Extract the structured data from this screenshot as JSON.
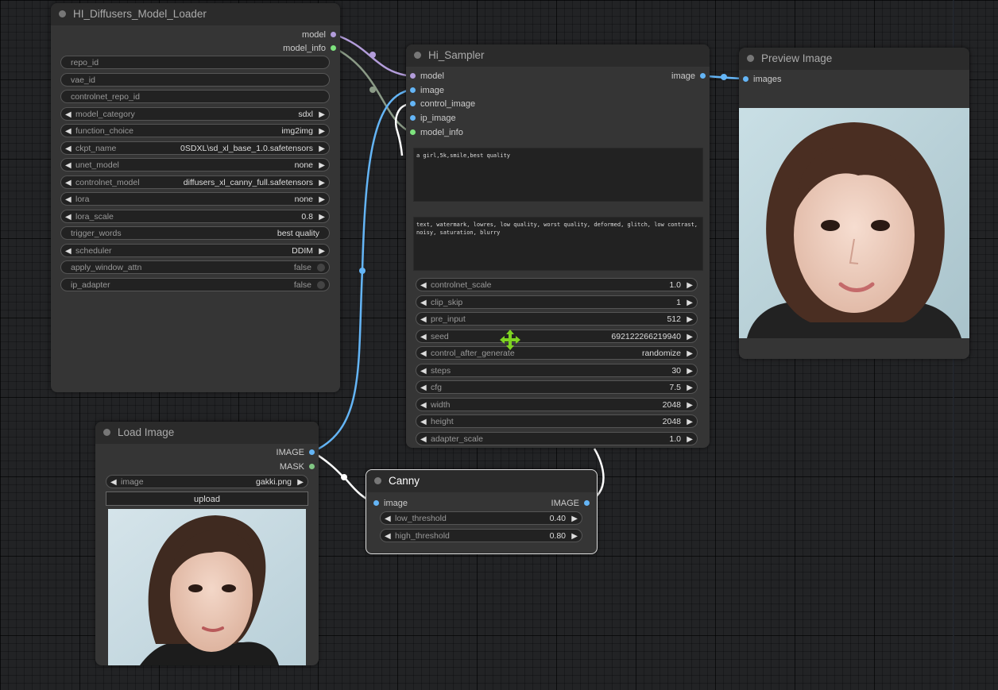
{
  "nodes": {
    "loader": {
      "title": "HI_Diffusers_Model_Loader",
      "outputs": [
        "model",
        "model_info"
      ],
      "widgets": [
        {
          "label": "repo_id",
          "value": "",
          "kind": "text"
        },
        {
          "label": "vae_id",
          "value": "",
          "kind": "text"
        },
        {
          "label": "controlnet_repo_id",
          "value": "",
          "kind": "text"
        },
        {
          "label": "model_category",
          "value": "sdxl",
          "kind": "combo"
        },
        {
          "label": "function_choice",
          "value": "img2img",
          "kind": "combo"
        },
        {
          "label": "ckpt_name",
          "value": "0SDXL\\sd_xl_base_1.0.safetensors",
          "kind": "combo"
        },
        {
          "label": "unet_model",
          "value": "none",
          "kind": "combo"
        },
        {
          "label": "controlnet_model",
          "value": "diffusers_xl_canny_full.safetensors",
          "kind": "combo"
        },
        {
          "label": "lora",
          "value": "none",
          "kind": "combo"
        },
        {
          "label": "lora_scale",
          "value": "0.8",
          "kind": "combo"
        },
        {
          "label": "trigger_words",
          "value": "best quality",
          "kind": "text"
        },
        {
          "label": "scheduler",
          "value": "DDIM",
          "kind": "combo"
        },
        {
          "label": "apply_window_attn",
          "value": "false",
          "kind": "toggle"
        },
        {
          "label": "ip_adapter",
          "value": "false",
          "kind": "toggle"
        }
      ]
    },
    "sampler": {
      "title": "Hi_Sampler",
      "inputs": [
        "model",
        "image",
        "control_image",
        "ip_image",
        "model_info"
      ],
      "outputs": [
        "image"
      ],
      "positive_prompt": "a girl,5k,smile,best quality",
      "negative_prompt": "text, watermark, lowres, low quality, worst quality, deformed, glitch, low contrast, noisy, saturation, blurry",
      "widgets": [
        {
          "label": "controlnet_scale",
          "value": "1.0"
        },
        {
          "label": "clip_skip",
          "value": "1"
        },
        {
          "label": "pre_input",
          "value": "512"
        },
        {
          "label": "seed",
          "value": "692122266219940"
        },
        {
          "label": "control_after_generate",
          "value": "randomize"
        },
        {
          "label": "steps",
          "value": "30"
        },
        {
          "label": "cfg",
          "value": "7.5"
        },
        {
          "label": "width",
          "value": "2048"
        },
        {
          "label": "height",
          "value": "2048"
        },
        {
          "label": "adapter_scale",
          "value": "1.0"
        }
      ]
    },
    "preview": {
      "title": "Preview Image",
      "inputs": [
        "images"
      ]
    },
    "load_image": {
      "title": "Load Image",
      "outputs": [
        "IMAGE",
        "MASK"
      ],
      "image_widget": {
        "label": "image",
        "value": "gakki.png"
      },
      "upload_label": "upload"
    },
    "canny": {
      "title": "Canny",
      "inputs": [
        "image"
      ],
      "outputs": [
        "IMAGE"
      ],
      "widgets": [
        {
          "label": "low_threshold",
          "value": "0.40"
        },
        {
          "label": "high_threshold",
          "value": "0.80"
        }
      ]
    }
  },
  "colors": {
    "model_slot": "#b39ddb",
    "model_info_slot": "#7ee37e",
    "image_slot": "#64b5f6",
    "mask_slot": "#81c784",
    "canvas": "#222325",
    "node_body": "#353535",
    "node_title": "#2b2b2b",
    "drag_cursor": "#7ed321"
  },
  "icons": {
    "drag_cursor": "move-arrows-icon",
    "arrows": "triangle-arrow-icon"
  }
}
